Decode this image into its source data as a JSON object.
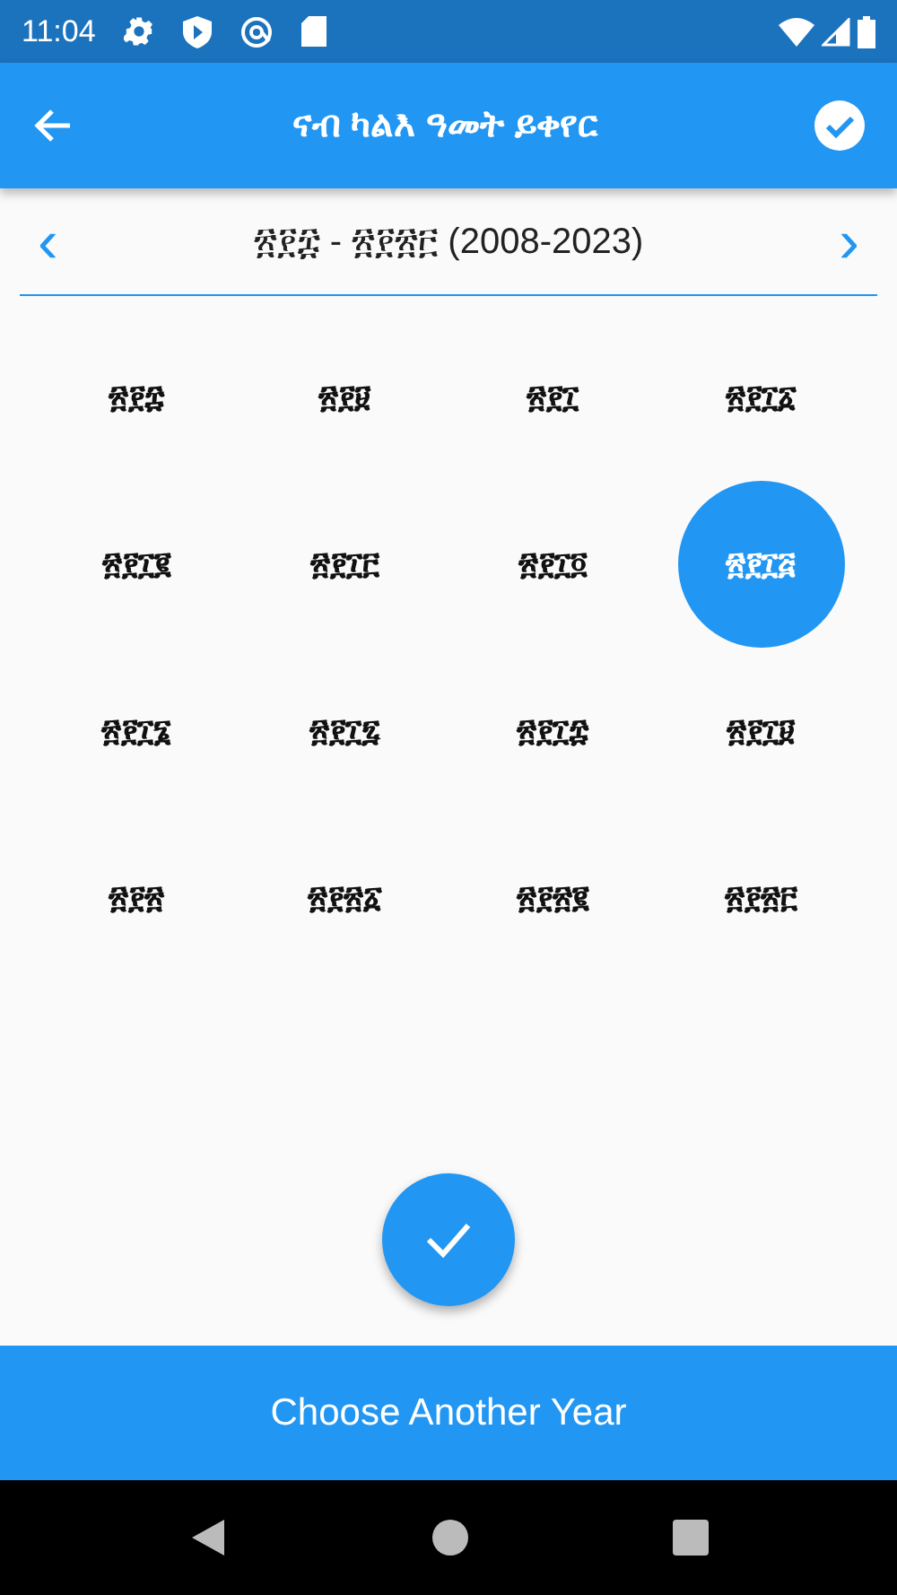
{
  "status_bar": {
    "time": "11:04"
  },
  "app_bar": {
    "title": "ናብ ካልእ ዓመት ይቀየር"
  },
  "range": {
    "prev": "‹",
    "label": "፳፻፰ - ፳፻፳፫ (2008-2023)",
    "next": "›"
  },
  "years": [
    {
      "label": "፳፻፰",
      "selected": false
    },
    {
      "label": "፳፻፱",
      "selected": false
    },
    {
      "label": "፳፻፲",
      "selected": false
    },
    {
      "label": "፳፻፲፩",
      "selected": false
    },
    {
      "label": "፳፻፲፪",
      "selected": false
    },
    {
      "label": "፳፻፲፫",
      "selected": false
    },
    {
      "label": "፳፻፲፬",
      "selected": false
    },
    {
      "label": "፳፻፲፭",
      "selected": true
    },
    {
      "label": "፳፻፲፮",
      "selected": false
    },
    {
      "label": "፳፻፲፯",
      "selected": false
    },
    {
      "label": "፳፻፲፰",
      "selected": false
    },
    {
      "label": "፳፻፲፱",
      "selected": false
    },
    {
      "label": "፳፻፳",
      "selected": false
    },
    {
      "label": "፳፻፳፩",
      "selected": false
    },
    {
      "label": "፳፻፳፪",
      "selected": false
    },
    {
      "label": "፳፻፳፫",
      "selected": false
    }
  ],
  "bottom_button": {
    "label": "Choose Another Year"
  }
}
